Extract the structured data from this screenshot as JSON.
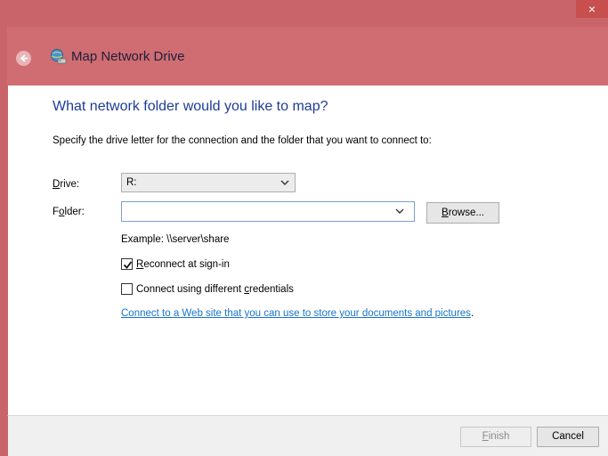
{
  "window": {
    "title": "Map Network Drive",
    "close_glyph": "×",
    "accent_color": "#c9646a"
  },
  "icons": {
    "back": "back-arrow-icon",
    "app": "network-drive-icon",
    "close": "close-icon",
    "dropdown": "chevron-down-icon",
    "checkbox": "checkmark-icon"
  },
  "main": {
    "heading": "What network folder would you like to map?",
    "description": "Specify the drive letter for the connection and the folder that you want to connect to:",
    "drive": {
      "label_accel": "D",
      "label_rest": "rive:",
      "value": "R:"
    },
    "folder": {
      "label_pre": "F",
      "label_accel": "o",
      "label_rest": "lder:",
      "value": "",
      "placeholder": ""
    },
    "browse": {
      "accel": "B",
      "rest": "rowse..."
    },
    "example": "Example: \\\\server\\share",
    "reconnect": {
      "checked": true,
      "accel": "R",
      "rest": "econnect at sign-in"
    },
    "credentials": {
      "checked": false,
      "pre": "Connect using different ",
      "accel": "c",
      "rest": "redentials"
    },
    "web_link": {
      "text": "Connect to a Web site that you can use to store your documents and pictures",
      "suffix": "."
    }
  },
  "footer": {
    "finish": {
      "accel": "F",
      "rest": "inish",
      "enabled": false
    },
    "cancel": "Cancel"
  }
}
